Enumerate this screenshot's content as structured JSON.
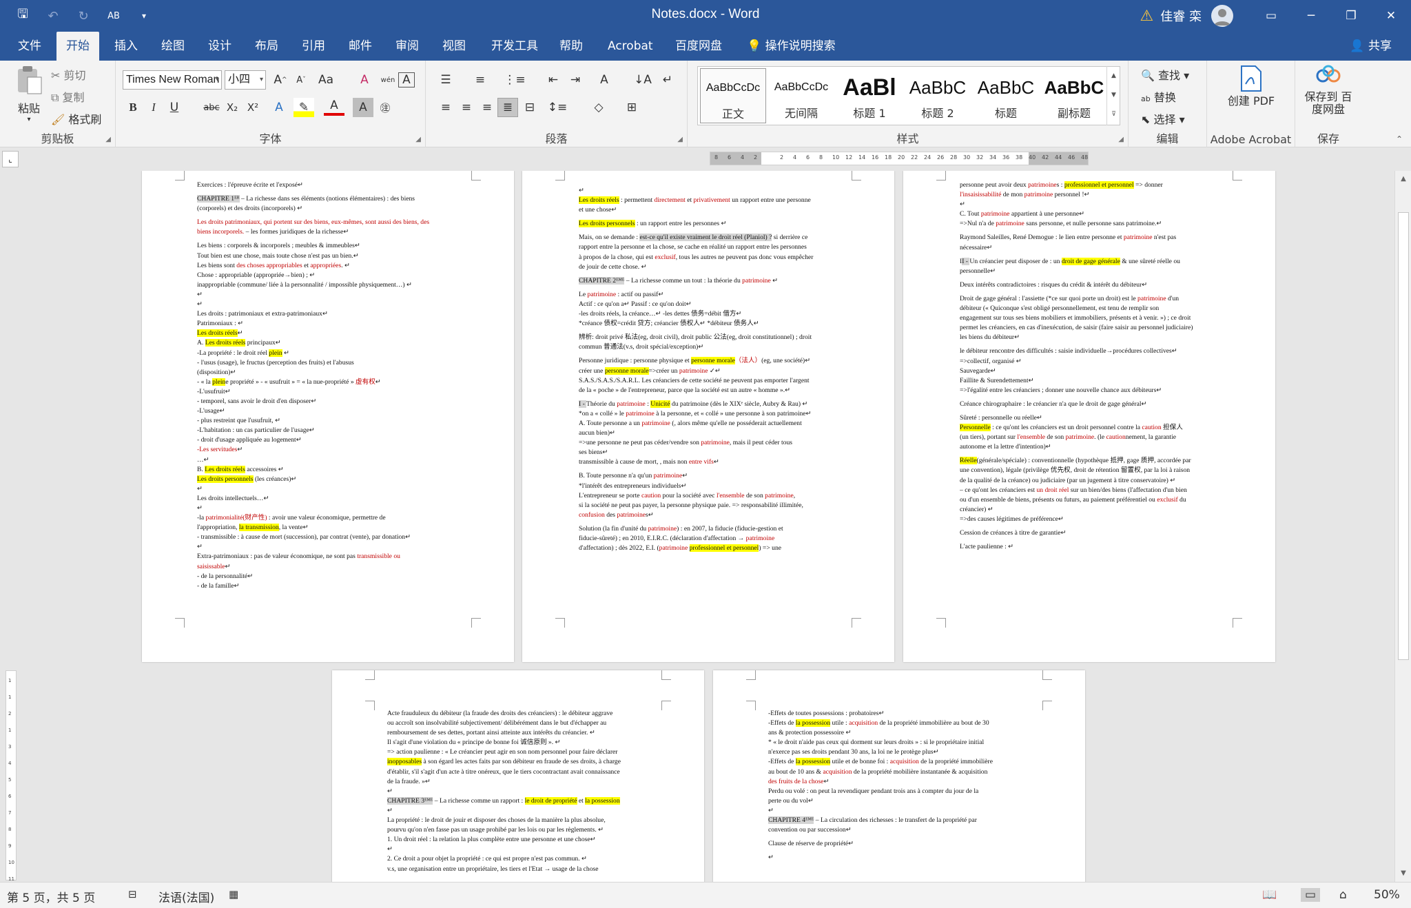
{
  "window": {
    "title": "Notes.docx  -  Word",
    "user": "佳睿 栾",
    "controls": [
      "▭",
      "─",
      "❐",
      "✕"
    ]
  },
  "qat": {
    "save": "🖫",
    "undo": "↶",
    "redo": "↻",
    "format": "AB",
    "more": "▾"
  },
  "tabs": [
    "文件",
    "开始",
    "插入",
    "绘图",
    "设计",
    "布局",
    "引用",
    "邮件",
    "审阅",
    "视图",
    "开发工具",
    "帮助",
    "Acrobat",
    "百度网盘",
    "操作说明搜索"
  ],
  "share": "共享",
  "clipboard": {
    "paste": "粘贴",
    "cut": "剪切",
    "copy": "复制",
    "painter": "格式刷",
    "label": "剪贴板"
  },
  "font": {
    "name": "Times New Roman",
    "size": "小四",
    "label": "字体"
  },
  "paragraph": {
    "label": "段落"
  },
  "styles": {
    "items": [
      {
        "preview": "AaBbCcDc",
        "name": "正文"
      },
      {
        "preview": "AaBbCcDc",
        "name": "无间隔"
      },
      {
        "preview": "AaBl",
        "name": "标题 1"
      },
      {
        "preview": "AaBbC",
        "name": "标题 2"
      },
      {
        "preview": "AaBbC",
        "name": "标题"
      },
      {
        "preview": "AaBbC",
        "name": "副标题"
      }
    ],
    "label": "样式"
  },
  "editing": {
    "find": "查找",
    "replace": "替换",
    "select": "选择",
    "label": "编辑"
  },
  "acrobat": {
    "create": "创建 PDF",
    "label": "Adobe Acrobat"
  },
  "save_group": {
    "save": "保存到 百度网盘",
    "label": "保存"
  },
  "ruler": {
    "numbers": [
      "8",
      "6",
      "4",
      "2",
      "",
      "2",
      "4",
      "6",
      "8",
      "10",
      "12",
      "14",
      "16",
      "18",
      "20",
      "22",
      "24",
      "26",
      "28",
      "30",
      "32",
      "34",
      "36",
      "38",
      "40",
      "42",
      "44",
      "46",
      "48"
    ],
    "vnumbers": [
      "1",
      "",
      "1",
      "",
      "2",
      "",
      "1",
      "",
      "3",
      "",
      "4",
      "",
      "5",
      "",
      "6",
      "",
      "7",
      "",
      "8",
      "",
      "9",
      "",
      "10",
      "",
      "11"
    ]
  },
  "status": {
    "pages": "第 5 页，共 5 页",
    "lang": "法语(法国)",
    "zoom": "50%"
  },
  "colors": {
    "accent": "#2b579a",
    "highlight": "#ffff00",
    "red": "#c00000"
  },
  "pages": {
    "p1": [
      "Exercices : l'épreuve écrite et l'exposé↵",
      "",
      "CHAPITRE 1ᴱᴿ – La richesse dans ses éléments (notions élémentaires) : des biens",
      "(corporels) et des droits (incorporels) ↵",
      "",
      "Les droits patrimoniaux, qui portent sur des biens, eux-mêmes, sont aussi des biens, des",
      "biens incorporels. – les formes juridiques de la richesse↵",
      "",
      "Les biens : corporels & incorporels ; meubles & immeubles↵",
      "Tout bien est une chose, mais toute chose n'est pas un bien.↵",
      "Les biens sont des choses appropriables et appropriées. ↵",
      "Chose : appropriable (appropriée→bien) ; ↵",
      "inappropriable (commune/ liée à la personnalité / impossible physiquement…) ↵",
      "↵",
      "↵",
      "Les droits : patrimoniaux et extra-patrimoniaux↵",
      "    Patrimoniaux : ↵",
      "    Les droits réels↵",
      "        A. Les droits réels principaux↵",
      "           -La propriété : le droit réel plein ↵",
      "              - l'usus (usage), le fructus (perception des fruits) et l'abusus",
      "              (disposition)↵",
      "              - « la pleine propriété » - « usufruit » = « la nue-propriété » 虚有权↵",
      "           -L'usufruit↵",
      "              - temporel, sans avoir le droit d'en disposer↵",
      "           -L'usage↵",
      "              - plus restreint que l'usufruit, ↵",
      "           -L'habitation : un cas particulier de l'usage↵",
      "              - droit d'usage appliquée au logement↵",
      "           -Les servitudes↵",
      "           …↵",
      "        B. Les droits réels accessoires ↵",
      "    Les droits personnels (les créances)↵",
      "    ↵",
      "    Les droits intellectuels…↵",
      "    ↵",
      "    -la patrimonialité(财产性) : avoir une valeur économique, permettre de",
      "    l'appropriation, la transmission, la vente↵",
      "    - transmissible : à cause de mort (succession), par contrat (vente), par donation↵",
      "↵",
      "    Extra-patrimoniaux : pas de valeur économique, ne sont pas transmissible ou",
      "    saisissable↵",
      "    - de la personnalité↵",
      "    - de la famille↵"
    ],
    "p2": [
      "↵",
      "Les droits réels : permettent directement et privativement un rapport entre une personne",
      "et une chose↵",
      "",
      "Les droits personnels : un rapport entre les personnes ↵",
      "",
      "Mais, on se demande : est-ce qu'il existe vraiment le droit réel (Planiol) ? si derrière ce",
      "rapport entre la personne et la chose, se cache en réalité un rapport entre les personnes",
      "à propos de la chose, qui est exclusif, tous les autres ne peuvent pas donc vous empêcher",
      "de jouir de cette chose. ↵",
      "",
      "CHAPITRE 2ᴱᴹᴱ – La richesse comme un tout : la théorie du patrimoine ↵",
      "",
      "Le patrimoine : actif ou passif↵",
      "Actif : ce qu'on a↵                                   Passif : ce qu'on doit↵",
      "-les droits réels, la créance…↵                       -les dettes 债务=débit 借方↵",
      "*créance 债权=crédit 贷方; créancier 债权人↵          *débiteur 债务人↵",
      "",
      "辨析: droit privé 私法(eg, droit civil), droit public 公法(eg, droit constitutionnel) ; droit",
      "commun 普通法(v.s, droit spécial/exception)↵",
      "",
      "Personne juridique : personne physique et personne morale（法人）(eg, une société)↵",
      "créer une personne morale=>créer un patrimoine ✓↵",
      "S.A.S./S.A.S./S.A.R.L. Les créanciers de cette société ne peuvent pas emporter l'argent",
      "de la « poche » de l'entrepreneur, parce que la société est un autre « homme ».↵",
      "",
      "I - Théorie du patrimoine : Unicité du patrimoine (dès le XIXᵉ siècle, Aubry & Rau) ↵",
      "*on a « collé » le patrimoine à la personne, et « collé » une personne à son patrimoine↵",
      "A.  Toute personne a un patrimoine (, alors même qu'elle ne posséderait actuellement",
      "      aucun bien)↵",
      "      =>une personne ne peut pas céder/vendre son patrimoine, mais il peut céder tous",
      "      ses biens↵",
      "      transmissible à cause de mort, , mais non entre vifs↵",
      "",
      "B.  Toute personne n'a qu'un patrimoine↵",
      "      *l'intérêt des entrepreneurs individuels↵",
      "      L'entrepreneur se porte caution pour la société avec l'ensemble de son patrimoine,",
      "      si la société ne peut pas payer, la personne physique paie. => responsabilité illimitée,",
      "      confusion des patrimoines↵",
      "",
      "      Solution (la fin d'unité du patrimoine) : en 2007, la fiducie (fiducie-gestion et",
      "      fiducie-sûreté) ; en 2010, E.I.R.C. (déclaration d'affectation → patrimoine",
      "      d'affectation) ; dès 2022, E.I. (patrimoine professionnel et personnel) => une"
    ],
    "p3": [
      "      personne peut avoir deux patrimoines : professionnel et personnel => donner",
      "      l'insaisissabilité de mon patrimoine personnel !↵",
      "↵",
      "C.  Tout patrimoine appartient à une personne↵",
      "=>Nul n'a de patrimoine sans personne, et nulle personne sans patrimoine.↵",
      "",
      "Raymond Saleilles, René Demogue : le lien entre personne et patrimoine n'est pas",
      "nécessaire↵",
      "",
      "II - Un créancier peut disposer de : un droit de gage générale & une sûreté réelle ou",
      "personnelle↵",
      "",
      "Deux intérêts contradictoires : risques du crédit & intérêt du débiteur↵",
      "",
      "Droit de gage général : l'assiette (*ce sur quoi porte un droit) est le patrimoine d'un",
      "débiteur (« Quiconque s'est obligé personnellement, est tenu de remplir son",
      "engagement sur tous ses biens mobiliers et immobiliers, présents et à venir. ») ; ce droit",
      "permet les créanciers, en cas d'inexécution, de saisir (faire saisir au personnel judiciaire)",
      "les biens du débiteur↵",
      "",
      "le débiteur rencontre des difficultés : saisie individuelle→procédures collectives↵",
      "=>collectif, organisé ↵",
      "Sauvegarde↵",
      "Faillite & Surendettement↵",
      "=>l'égalité entre les créanciers ; donner une nouvelle chance aux débiteurs↵",
      "",
      "Créance chirographaire : le créancier n'a que le droit de gage général↵",
      "",
      "Sûreté : personnelle ou réelle↵",
      "Personnelle : ce qu'ont les créanciers est un droit personnel contre la caution 担保人",
      "(un tiers), portant sur l'ensemble de son patrimoine. (le cautionnement, la garantie",
      "autonome et la lettre d'intention)↵",
      "",
      "Réelle(générale/spéciale) : conventionnelle (hypothèque 抵押, gage 质押, accordée par",
      "une convention), légale (privilège 优先权, droit de rétention 留置权, par la loi à raison",
      "de la qualité de la créance) ou judiciaire (par un jugement à titre conservatoire) ↵",
      "– ce qu'ont les créanciers est un droit réel sur un bien/des biens (l'affectation d'un bien",
      "ou d'un ensemble de biens, présents ou futurs, au paiement préférentiel ou exclusif du",
      "créancier) ↵",
      "=>des causes légitimes de préférence↵",
      "",
      "Cession de créances à titre de garantie↵",
      "",
      "L'acte paulienne : ↵"
    ],
    "p4": [
      "Acte frauduleux du débiteur (la fraude des droits des créanciers) : le débiteur aggrave",
      "ou accroît son insolvabilité subjectivement/ délibérément dans le but d'échapper au",
      "remboursement de ses dettes, portant ainsi atteinte aux intérêts du créancier. ↵",
      "Il s'agit d'une violation du « principe de bonne foi 诚信原则 ». ↵",
      "=> action paulienne : « Le créancier peut agir en son nom personnel pour faire déclarer",
      "inopposables à son égard les actes faits par son débiteur en fraude de ses droits, à charge",
      "d'établir, s'il s'agit d'un acte à titre onéreux, que le tiers cocontractant avait connaissance",
      "de la fraude. »↵",
      "↵",
      "CHAPITRE 3ᴱᴹᴱ – La richesse comme un rapport : le droit de propriété et la possession",
      "↵",
      "La propriété : le droit de jouir et disposer des choses de la manière la plus absolue,",
      "pourvu qu'on n'en fasse pas un usage prohibé par les lois ou par les règlements. ↵",
      "1.   Un droit réel : la relation la plus complète entre une personne et une chose↵",
      "        ↵",
      "2.   Ce droit a pour objet la propriété : ce qui est propre n'est pas commun. ↵",
      "      v.s, une organisation entre un propriétaire, les tiers et l'Etat → usage de la chose"
    ],
    "p5": [
      "-Effets de toutes possessions : probatoires↵",
      "-Effets de la possession utile : acquisition de la propriété immobilière au bout de 30",
      "ans & protection possessoire ↵",
      "  * « le droit n'aide pas ceux qui dorment sur leurs droits » : si le propriétaire initial",
      "  n'exerce pas ses droits pendant 30 ans, la loi ne le protège plus↵",
      "-Effets de la possession utile et de bonne foi : acquisition de la propriété immobilière",
      "au bout de 10 ans & acquisition de la propriété mobilière instantanée & acquisition",
      "des fruits de la chose↵",
      "  Perdu ou volé : on peut la revendiquer pendant trois ans à compter du jour de la",
      "  perte ou du vol↵",
      "↵",
      "CHAPITRE 4ᴱᴹᴱ – La circulation des richesses : le transfert de la propriété par",
      "convention ou par succession↵",
      "",
      "Clause de réserve de propriété↵",
      "",
      "↵"
    ]
  }
}
